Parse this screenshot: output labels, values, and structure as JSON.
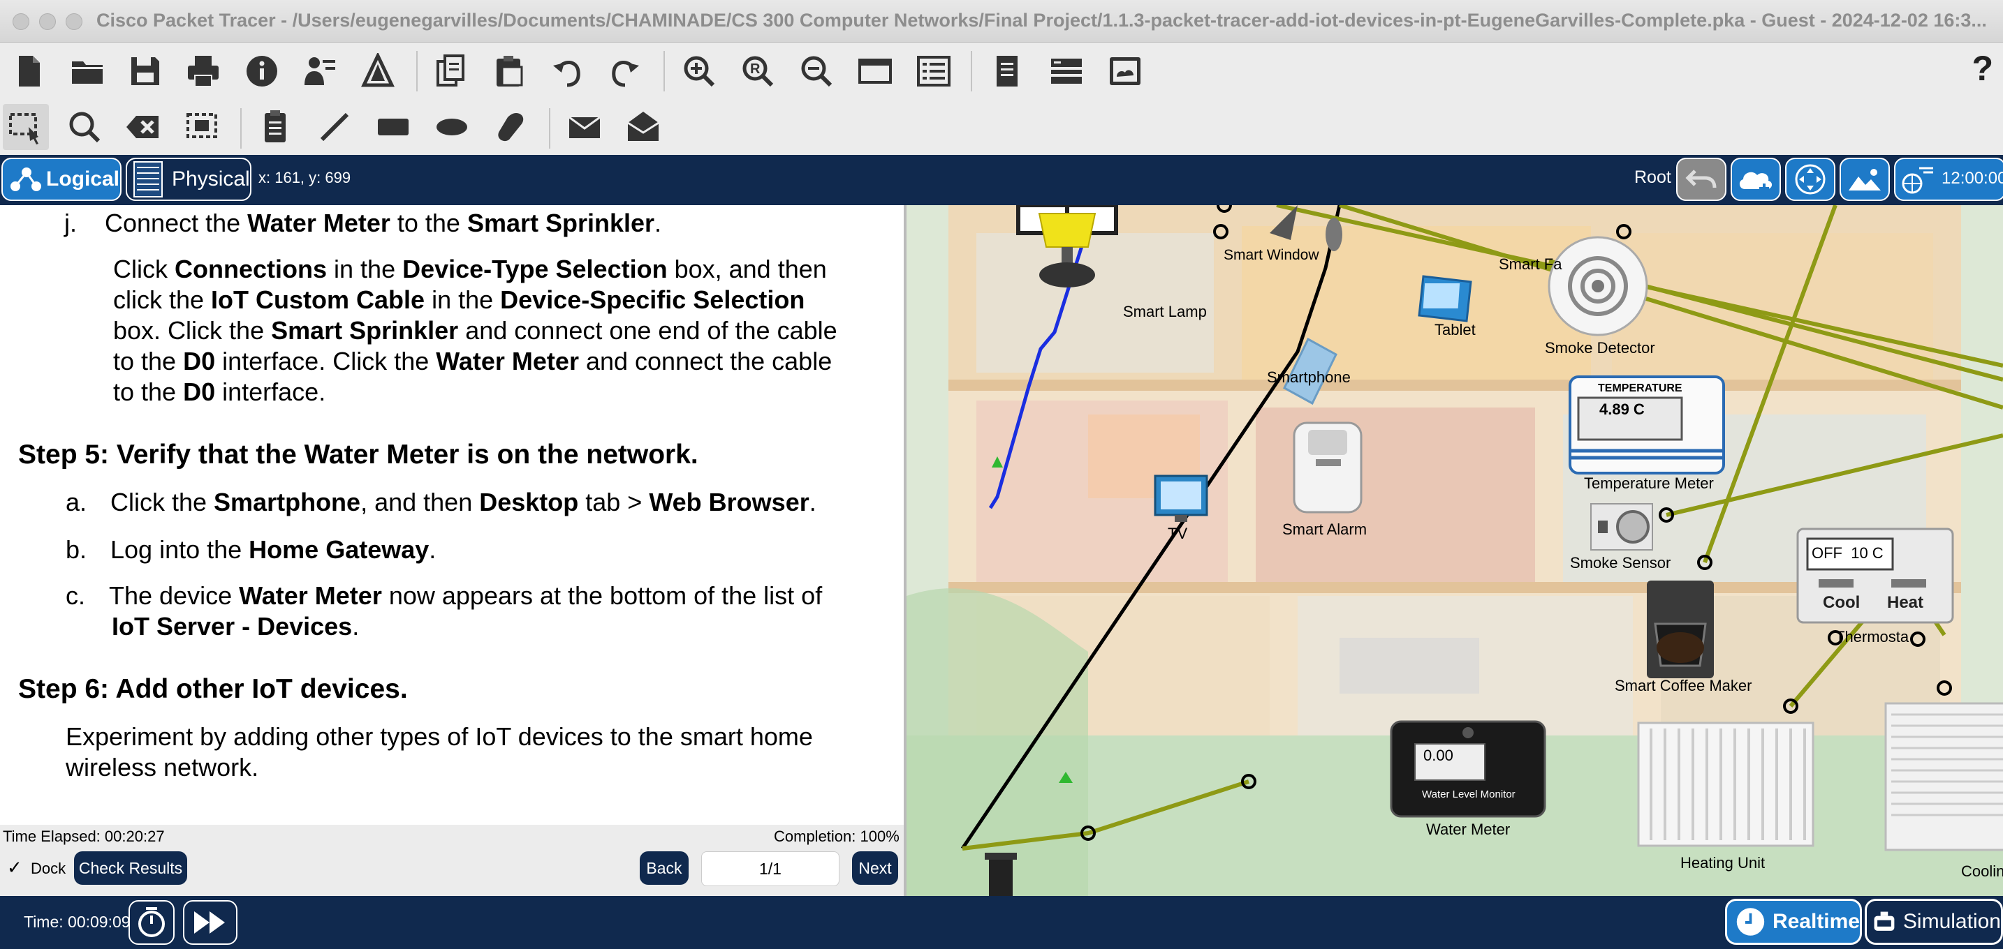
{
  "window": {
    "title": "Cisco Packet Tracer - /Users/eugenegarvilles/Documents/CHAMINADE/CS 300 Computer Networks/Final Project/1.1.3-packet-tracer-add-iot-devices-in-pt-EugeneGarvilles-Complete.pka - Guest - 2024-12-02 16:3..."
  },
  "toolbar_main": {
    "icons": [
      "new-file-icon",
      "open-folder-icon",
      "save-icon",
      "print-icon",
      "info-icon",
      "activity-wizard-icon",
      "custom-device-icon",
      "copy-icon",
      "paste-icon",
      "undo-icon",
      "redo-icon",
      "zoom-in-icon",
      "zoom-reset-icon",
      "zoom-out-icon",
      "drawing-palette-icon",
      "custom-devices-dialog-icon",
      "viewport-icon",
      "cluster-icon",
      "pdu-list-icon"
    ],
    "help_label": "?"
  },
  "toolbar_tools": {
    "icons": [
      "select-icon",
      "inspect-icon",
      "delete-icon",
      "resize-shape-icon",
      "place-note-icon",
      "draw-line-icon",
      "draw-rectangle-icon",
      "draw-ellipse-icon",
      "draw-freeform-icon",
      "add-simple-pdu-icon",
      "add-complex-pdu-icon"
    ]
  },
  "nav": {
    "logical_label": "Logical",
    "physical_label": "Physical",
    "coordinates": "x: 161, y: 699",
    "root_label": "Root",
    "clock": "12:00:00"
  },
  "instructions": {
    "step_j_letter": "j.",
    "step_j_pre": "Connect the ",
    "step_j_b1": "Water Meter",
    "step_j_mid": " to the ",
    "step_j_b2": "Smart Sprinkler",
    "step_j_end": ".",
    "para1_t1": "Click ",
    "para1_b1": "Connections",
    "para1_t2": " in the ",
    "para1_b2": "Device-Type Selection",
    "para1_t3": " box, and then",
    "para2_t1": "click the ",
    "para2_b1": "IoT Custom Cable",
    "para2_t2": " in the ",
    "para2_b2": "Device-Specific Selection",
    "para3_t1": "box. Click the ",
    "para3_b1": "Smart Sprinkler",
    "para3_t2": " and connect one end of the cable",
    "para4_t1": "to the ",
    "para4_b1": "D0",
    "para4_t2": " interface. Click the ",
    "para4_b2": "Water Meter",
    "para4_t3": " and connect the cable",
    "para5_t1": "to the ",
    "para5_b1": "D0",
    "para5_t2": " interface.",
    "step5_heading": "Step 5: Verify that the Water Meter is on the network.",
    "a_letter": "a.",
    "a_t1": "Click the ",
    "a_b1": "Smartphone",
    "a_t2": ", and then ",
    "a_b2": "Desktop",
    "a_t3": " tab > ",
    "a_b3": "Web Browser",
    "a_t4": ".",
    "b_letter": "b.",
    "b_t1": "Log into the ",
    "b_b1": "Home Gateway",
    "b_t2": ".",
    "c_letter": "c.",
    "c_t1": "The device ",
    "c_b1": "Water Meter",
    "c_t2": " now appears at the bottom of the list of",
    "c_b2": "IoT Server - Devices",
    "c_t3": ".",
    "step6_heading": "Step 6: Add other IoT devices.",
    "step6_line1": "Experiment by adding other types of IoT devices to the smart home",
    "step6_line2": "wireless network."
  },
  "status": {
    "time_elapsed": "Time Elapsed: 00:20:27",
    "completion": "Completion: 100%",
    "dock_label": "Dock",
    "dock_checked": true,
    "check_results_label": "Check Results",
    "back_label": "Back",
    "page_value": "1/1",
    "next_label": "Next"
  },
  "canvas": {
    "devices": {
      "smart_window": "Smart Window",
      "smart_lamp": "Smart Lamp",
      "smart_fan": "Smart Fa",
      "tablet": "Tablet",
      "smoke_detector": "Smoke Detector",
      "smartphone": "Smartphone",
      "temperature_meter": "Temperature Meter",
      "temperature_header": "TEMPERATURE",
      "temperature_value": "4.89 C",
      "tv": "TV",
      "smart_alarm": "Smart Alarm",
      "smoke_sensor": "Smoke Sensor",
      "thermostat": "Thermosta",
      "thermostat_display": "OFF  10 C",
      "thermostat_cool": "Cool",
      "thermostat_heat": "Heat",
      "smart_coffee_maker": "Smart Coffee Maker",
      "water_meter": "Water Meter",
      "water_meter_value": "0.00",
      "water_meter_panel": "Water Level Monitor",
      "heating_unit": "Heating Unit",
      "cooling": "Coolin"
    },
    "colors": {
      "iot_cable": "#8e9a15",
      "copper_cable": "#000000",
      "wireless_link": "#1a2ee0"
    }
  },
  "bottom": {
    "time": "Time: 00:09:09",
    "realtime_label": "Realtime",
    "simulation_label": "Simulation"
  }
}
